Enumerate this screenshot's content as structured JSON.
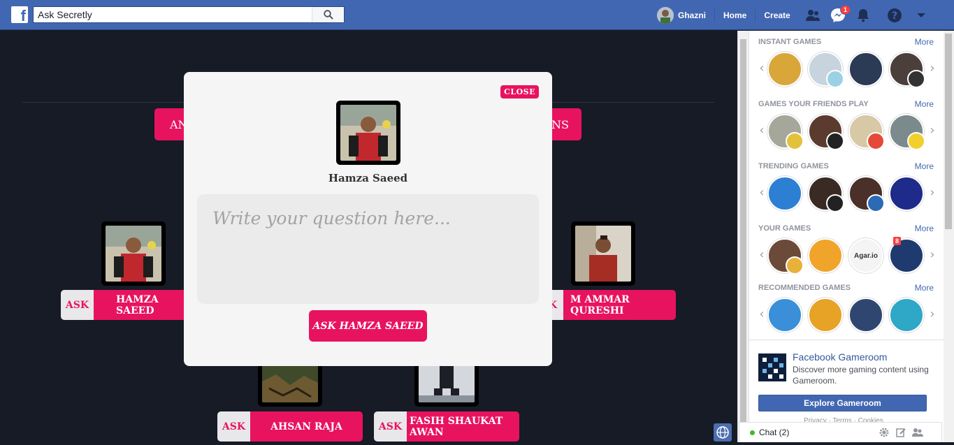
{
  "topbar": {
    "logo": "f",
    "search_value": "Ask Secretly",
    "user_name": "Ghazni",
    "nav_home": "Home",
    "nav_create": "Create",
    "messenger_badge": "1"
  },
  "main": {
    "top_pills": [
      {
        "label": "AN"
      },
      {
        "label": "NS"
      }
    ],
    "cards": [
      {
        "ask": "ASK",
        "name": "HAMZA SAEED"
      },
      {
        "ask": "K",
        "name": "M AMMAR QURESHI"
      },
      {
        "ask": "ASK",
        "name": "AHSAN RAJA"
      },
      {
        "ask": "ASK",
        "name": "FASIH SHAUKAT AWAN"
      }
    ]
  },
  "modal": {
    "close_label": "CLOSE",
    "person_name": "Hamza Saeed",
    "question_placeholder": "Write your question here...",
    "ask_button": "ASK HAMZA SAEED"
  },
  "sidebar": {
    "sections": [
      {
        "title": "INSTANT GAMES",
        "more": "More"
      },
      {
        "title": "GAMES YOUR FRIENDS PLAY",
        "more": "More"
      },
      {
        "title": "TRENDING GAMES",
        "more": "More"
      },
      {
        "title": "YOUR GAMES",
        "more": "More"
      },
      {
        "title": "RECOMMENDED GAMES",
        "more": "More"
      }
    ],
    "your_games_badge": "8",
    "agar_label": "Agar.io",
    "gameroom": {
      "title": "Facebook Gameroom",
      "desc": "Discover more gaming content using Gameroom.",
      "button": "Explore Gameroom",
      "links": "Privacy · Terms · Cookies"
    }
  },
  "chat": {
    "label": "Chat (2)"
  },
  "colors": {
    "brand_blue": "#4267b2",
    "accent_pink": "#e8135f",
    "page_bg": "#161b26"
  }
}
